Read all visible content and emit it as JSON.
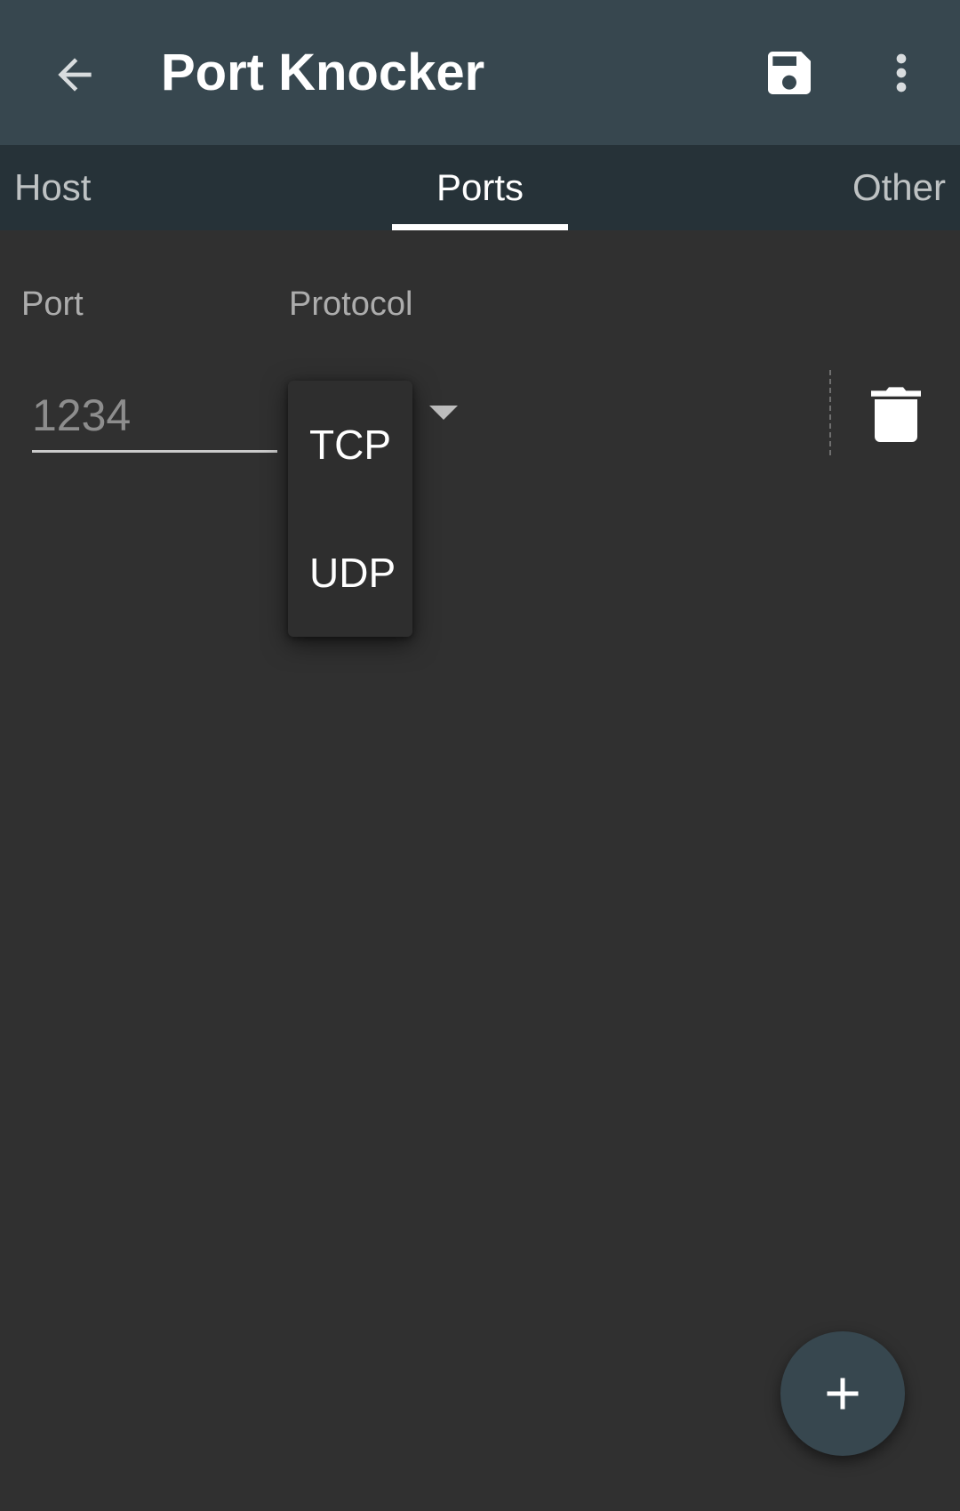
{
  "appbar": {
    "title": "Port Knocker",
    "back_icon": "arrow-back-icon",
    "save_icon": "save-icon",
    "more_icon": "more-vert-icon",
    "color": "#37474f"
  },
  "tabs": [
    {
      "label": "Host",
      "active": false
    },
    {
      "label": "Ports",
      "active": true
    },
    {
      "label": "Other",
      "active": false
    }
  ],
  "tabs_color": "#263238",
  "columns": {
    "port": "Port",
    "protocol": "Protocol"
  },
  "port_row": {
    "port_placeholder": "1234",
    "port_value": "",
    "delete_icon": "trash-icon"
  },
  "protocol_menu": {
    "items": [
      "TCP",
      "UDP"
    ]
  },
  "fab": {
    "icon": "plus-icon"
  },
  "background": "#303030"
}
